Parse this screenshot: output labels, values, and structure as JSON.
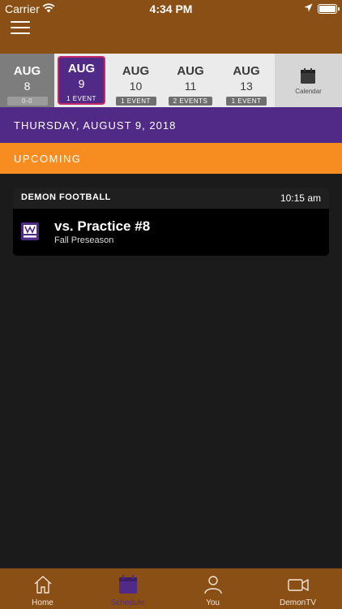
{
  "status_bar": {
    "carrier": "Carrier",
    "time": "4:34 PM"
  },
  "dates": [
    {
      "month": "AUG",
      "day": "8",
      "events": "0-0",
      "state": "past"
    },
    {
      "month": "AUG",
      "day": "9",
      "events": "1 EVENT",
      "state": "selected"
    },
    {
      "month": "AUG",
      "day": "10",
      "events": "1 EVENT",
      "state": "upcoming"
    },
    {
      "month": "AUG",
      "day": "11",
      "events": "2 EVENTS",
      "state": "upcoming"
    },
    {
      "month": "AUG",
      "day": "13",
      "events": "1 EVENT",
      "state": "upcoming"
    }
  ],
  "calendar_label": "Calendar",
  "day_header": "THURSDAY, AUGUST 9, 2018",
  "section_header": "UPCOMING",
  "event": {
    "team": "DEMON FOOTBALL",
    "time": "10:15 am",
    "title": "vs. Practice #8",
    "subtitle": "Fall Preseason",
    "logo_icon": "team-logo-icon"
  },
  "tabs": [
    {
      "label": "Home",
      "icon": "home-icon",
      "active": false
    },
    {
      "label": "Schedule",
      "icon": "calendar-icon",
      "active": true
    },
    {
      "label": "You",
      "icon": "person-icon",
      "active": false
    },
    {
      "label": "DemonTV",
      "icon": "video-camera-icon",
      "active": false
    }
  ],
  "colors": {
    "header_brown": "#8a4f14",
    "purple": "#512a87",
    "orange": "#f78c21",
    "selected_border": "#c4286a",
    "background": "#1b1b1b"
  }
}
